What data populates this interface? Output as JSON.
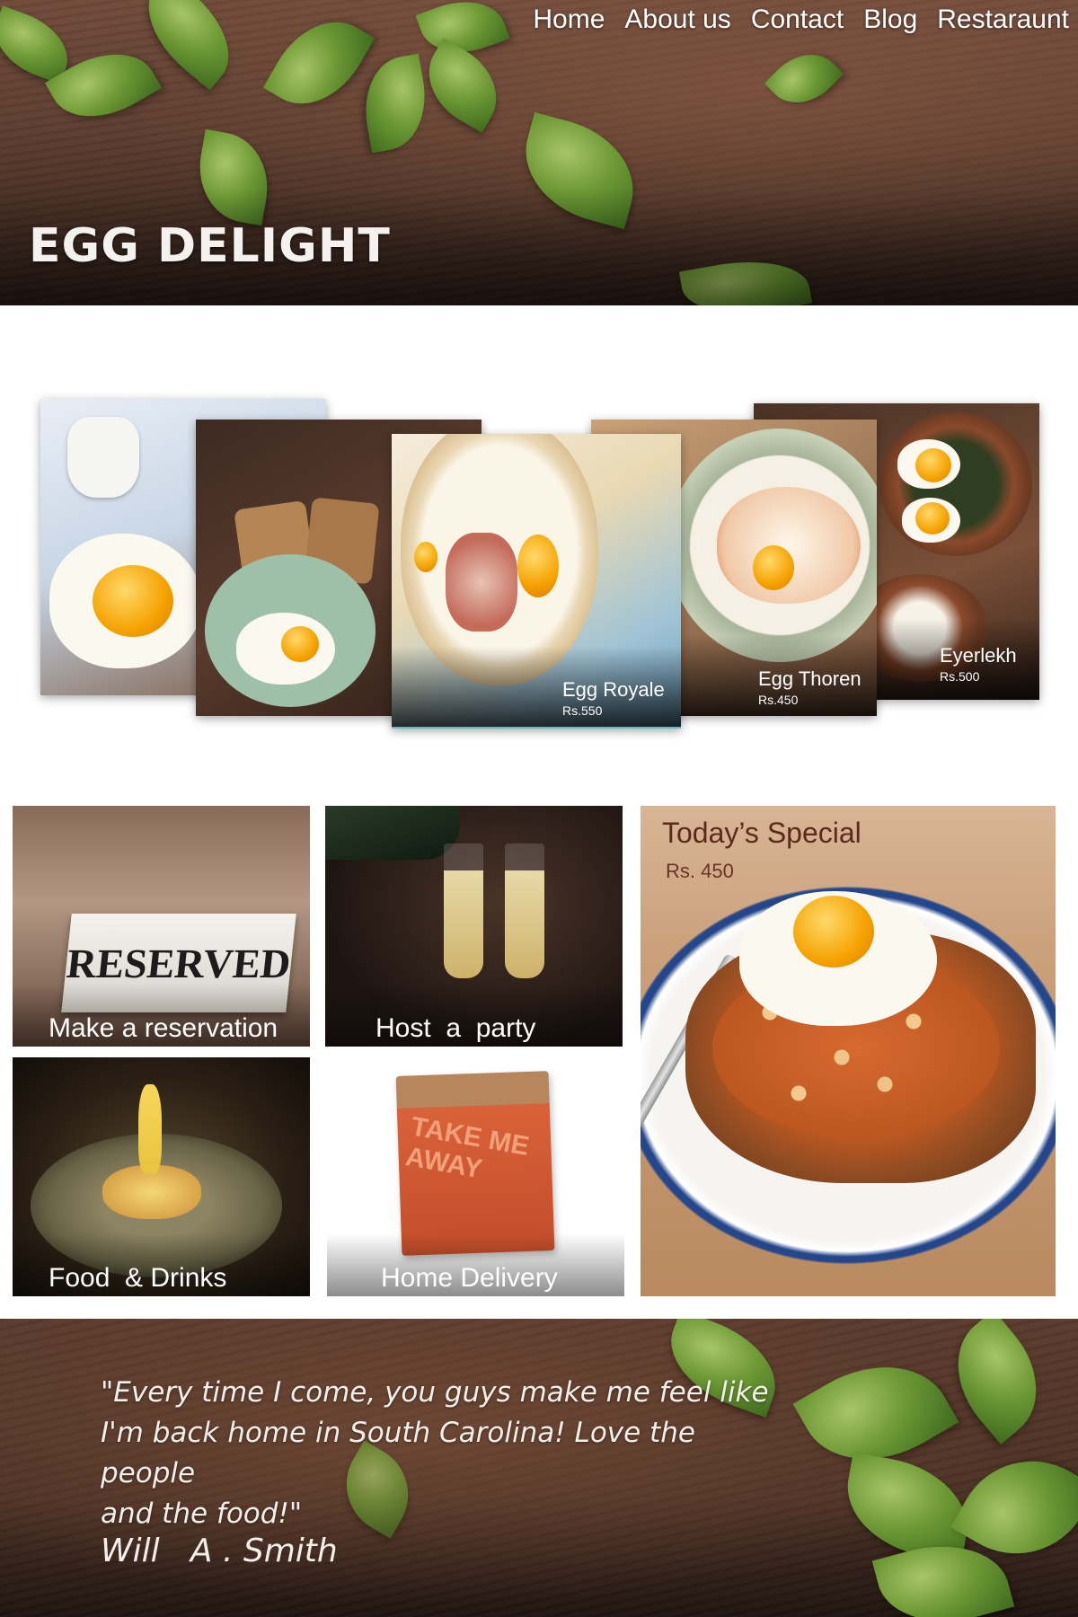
{
  "nav": {
    "items": [
      "Home",
      "About us",
      "Contact",
      "Blog",
      "Restaraunt"
    ]
  },
  "hero": {
    "brand": "EGG DELIGHT"
  },
  "carousel": {
    "items": [
      {
        "name": "",
        "price": ""
      },
      {
        "name": "",
        "price": ""
      },
      {
        "name": "Egg Royale",
        "price": "Rs.550"
      },
      {
        "name": "Egg Thoren",
        "price": "Rs.450"
      },
      {
        "name": "Eyerlekh",
        "price": "Rs.500"
      }
    ]
  },
  "tiles": {
    "reservation": {
      "label": "Make a reservation",
      "sign_text": "RESERVED"
    },
    "party": {
      "label": "Host  a  party"
    },
    "food": {
      "label": "Food  & Drinks"
    },
    "delivery": {
      "label": "Home Delivery",
      "bag_text": "TAKE ME AWAY"
    }
  },
  "special": {
    "title": "Today’s Special",
    "price": "Rs. 450"
  },
  "testimonial": {
    "quote": "\"Every time I come, you guys make me feel like\nI'm back home in South Carolina! Love the people\n and the food!\"",
    "author": "Will   A . Smith"
  },
  "colors": {
    "wood_dark": "#5c3c2e",
    "leaf_green": "#6f9a36",
    "special_title": "#5c2a1a",
    "yolk": "#f5a200"
  }
}
